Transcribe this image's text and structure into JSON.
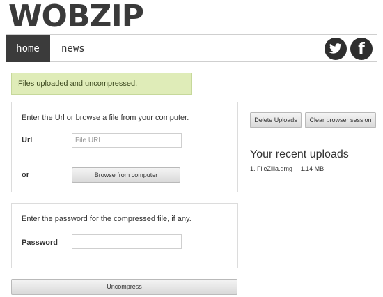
{
  "brand": {
    "logo_text": "WOBZIP"
  },
  "nav": {
    "items": [
      {
        "label": "home",
        "active": true
      },
      {
        "label": "news",
        "active": false
      }
    ],
    "social": [
      {
        "icon": "twitter-icon"
      },
      {
        "icon": "facebook-icon",
        "glyph": "f"
      }
    ]
  },
  "alert": {
    "message": "Files uploaded and uncompressed.",
    "color": "#dfecb8"
  },
  "url_panel": {
    "instruction": "Enter the Url or browse a file from your computer.",
    "url_label": "Url",
    "url_placeholder": "File URL",
    "or_label": "or",
    "browse_button": "Browse from computer"
  },
  "password_panel": {
    "instruction": "Enter the password for the compressed file, if any.",
    "password_label": "Password",
    "password_value": ""
  },
  "actions": {
    "uncompress_button": "Uncompress",
    "delete_button": "Delete Uploads",
    "clear_button": "Clear browser session"
  },
  "recent": {
    "title": "Your recent uploads",
    "items": [
      {
        "index": "1.",
        "name": "FileZilla.dmg",
        "size": "1.14 MB"
      }
    ]
  },
  "colors": {
    "nav_active_bg": "#3b3b3b",
    "logo": "#3a3a3a"
  }
}
